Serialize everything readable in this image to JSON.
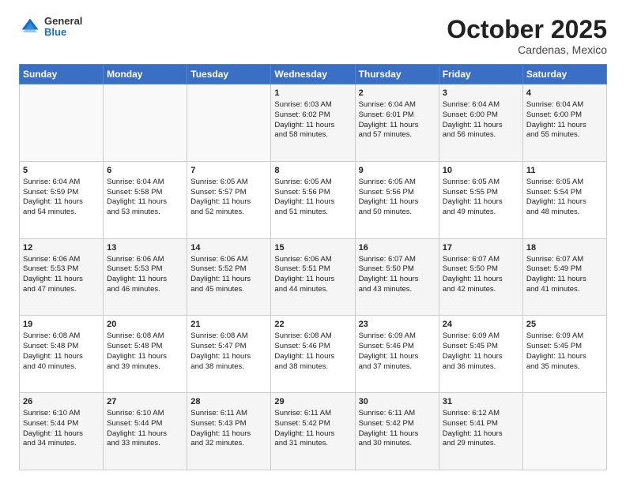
{
  "header": {
    "logo_general": "General",
    "logo_blue": "Blue",
    "month": "October 2025",
    "location": "Cardenas, Mexico"
  },
  "days_of_week": [
    "Sunday",
    "Monday",
    "Tuesday",
    "Wednesday",
    "Thursday",
    "Friday",
    "Saturday"
  ],
  "weeks": [
    [
      {
        "day": "",
        "content": ""
      },
      {
        "day": "",
        "content": ""
      },
      {
        "day": "",
        "content": ""
      },
      {
        "day": "1",
        "content": "Sunrise: 6:03 AM\nSunset: 6:02 PM\nDaylight: 11 hours\nand 58 minutes."
      },
      {
        "day": "2",
        "content": "Sunrise: 6:04 AM\nSunset: 6:01 PM\nDaylight: 11 hours\nand 57 minutes."
      },
      {
        "day": "3",
        "content": "Sunrise: 6:04 AM\nSunset: 6:00 PM\nDaylight: 11 hours\nand 56 minutes."
      },
      {
        "day": "4",
        "content": "Sunrise: 6:04 AM\nSunset: 6:00 PM\nDaylight: 11 hours\nand 55 minutes."
      }
    ],
    [
      {
        "day": "5",
        "content": "Sunrise: 6:04 AM\nSunset: 5:59 PM\nDaylight: 11 hours\nand 54 minutes."
      },
      {
        "day": "6",
        "content": "Sunrise: 6:04 AM\nSunset: 5:58 PM\nDaylight: 11 hours\nand 53 minutes."
      },
      {
        "day": "7",
        "content": "Sunrise: 6:05 AM\nSunset: 5:57 PM\nDaylight: 11 hours\nand 52 minutes."
      },
      {
        "day": "8",
        "content": "Sunrise: 6:05 AM\nSunset: 5:56 PM\nDaylight: 11 hours\nand 51 minutes."
      },
      {
        "day": "9",
        "content": "Sunrise: 6:05 AM\nSunset: 5:56 PM\nDaylight: 11 hours\nand 50 minutes."
      },
      {
        "day": "10",
        "content": "Sunrise: 6:05 AM\nSunset: 5:55 PM\nDaylight: 11 hours\nand 49 minutes."
      },
      {
        "day": "11",
        "content": "Sunrise: 6:05 AM\nSunset: 5:54 PM\nDaylight: 11 hours\nand 48 minutes."
      }
    ],
    [
      {
        "day": "12",
        "content": "Sunrise: 6:06 AM\nSunset: 5:53 PM\nDaylight: 11 hours\nand 47 minutes."
      },
      {
        "day": "13",
        "content": "Sunrise: 6:06 AM\nSunset: 5:53 PM\nDaylight: 11 hours\nand 46 minutes."
      },
      {
        "day": "14",
        "content": "Sunrise: 6:06 AM\nSunset: 5:52 PM\nDaylight: 11 hours\nand 45 minutes."
      },
      {
        "day": "15",
        "content": "Sunrise: 6:06 AM\nSunset: 5:51 PM\nDaylight: 11 hours\nand 44 minutes."
      },
      {
        "day": "16",
        "content": "Sunrise: 6:07 AM\nSunset: 5:50 PM\nDaylight: 11 hours\nand 43 minutes."
      },
      {
        "day": "17",
        "content": "Sunrise: 6:07 AM\nSunset: 5:50 PM\nDaylight: 11 hours\nand 42 minutes."
      },
      {
        "day": "18",
        "content": "Sunrise: 6:07 AM\nSunset: 5:49 PM\nDaylight: 11 hours\nand 41 minutes."
      }
    ],
    [
      {
        "day": "19",
        "content": "Sunrise: 6:08 AM\nSunset: 5:48 PM\nDaylight: 11 hours\nand 40 minutes."
      },
      {
        "day": "20",
        "content": "Sunrise: 6:08 AM\nSunset: 5:48 PM\nDaylight: 11 hours\nand 39 minutes."
      },
      {
        "day": "21",
        "content": "Sunrise: 6:08 AM\nSunset: 5:47 PM\nDaylight: 11 hours\nand 38 minutes."
      },
      {
        "day": "22",
        "content": "Sunrise: 6:08 AM\nSunset: 5:46 PM\nDaylight: 11 hours\nand 38 minutes."
      },
      {
        "day": "23",
        "content": "Sunrise: 6:09 AM\nSunset: 5:46 PM\nDaylight: 11 hours\nand 37 minutes."
      },
      {
        "day": "24",
        "content": "Sunrise: 6:09 AM\nSunset: 5:45 PM\nDaylight: 11 hours\nand 36 minutes."
      },
      {
        "day": "25",
        "content": "Sunrise: 6:09 AM\nSunset: 5:45 PM\nDaylight: 11 hours\nand 35 minutes."
      }
    ],
    [
      {
        "day": "26",
        "content": "Sunrise: 6:10 AM\nSunset: 5:44 PM\nDaylight: 11 hours\nand 34 minutes."
      },
      {
        "day": "27",
        "content": "Sunrise: 6:10 AM\nSunset: 5:44 PM\nDaylight: 11 hours\nand 33 minutes."
      },
      {
        "day": "28",
        "content": "Sunrise: 6:11 AM\nSunset: 5:43 PM\nDaylight: 11 hours\nand 32 minutes."
      },
      {
        "day": "29",
        "content": "Sunrise: 6:11 AM\nSunset: 5:42 PM\nDaylight: 11 hours\nand 31 minutes."
      },
      {
        "day": "30",
        "content": "Sunrise: 6:11 AM\nSunset: 5:42 PM\nDaylight: 11 hours\nand 30 minutes."
      },
      {
        "day": "31",
        "content": "Sunrise: 6:12 AM\nSunset: 5:41 PM\nDaylight: 11 hours\nand 29 minutes."
      },
      {
        "day": "",
        "content": ""
      }
    ]
  ]
}
